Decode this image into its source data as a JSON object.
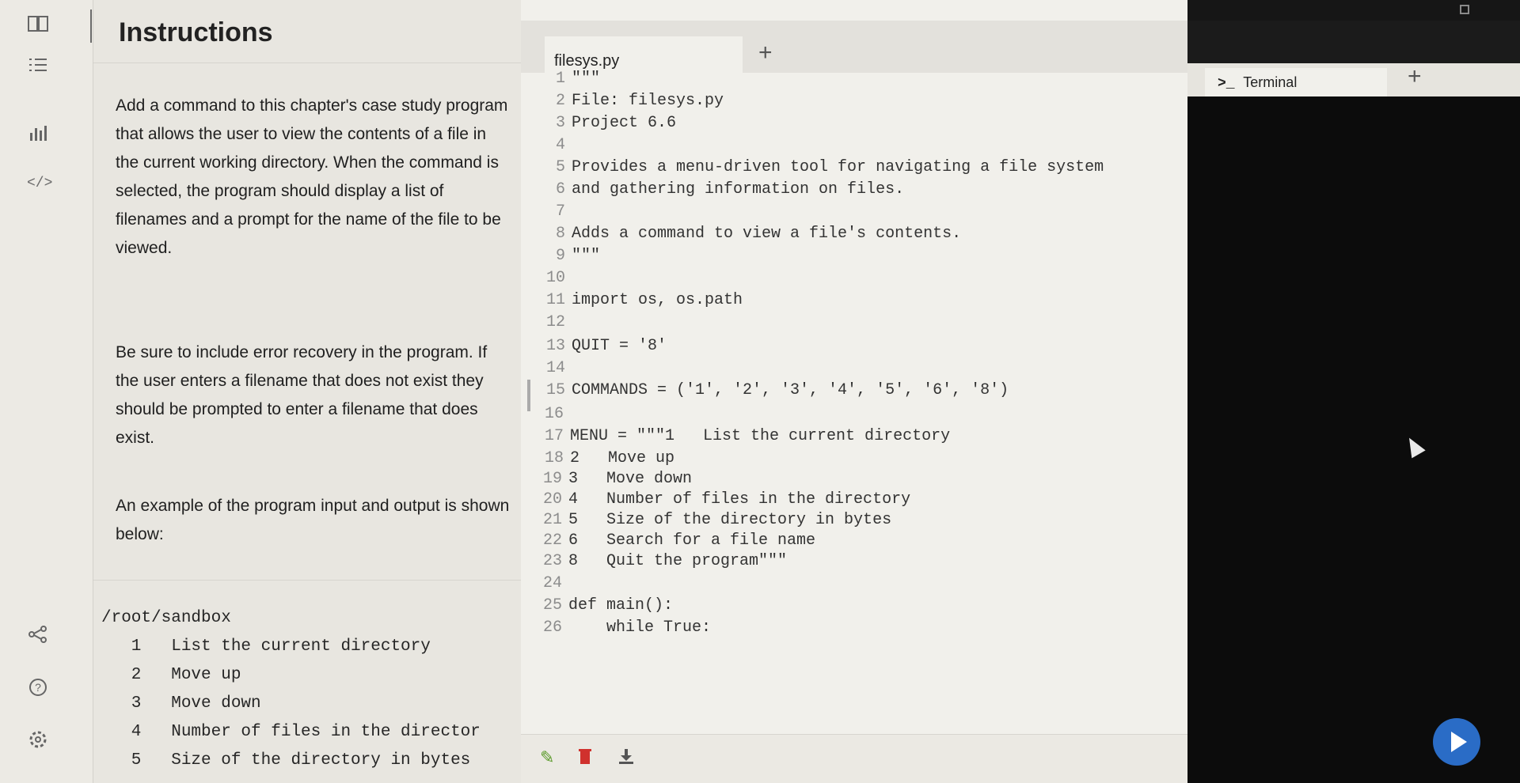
{
  "instructions": {
    "title": "Instructions",
    "paragraph1": "Add a command to this chapter's case study program that allows the user to view the contents of a file in the current working directory. When the command is selected, the program should display a list of filenames and a prompt for the name of the file to be viewed.",
    "paragraph2": "Be sure to include error recovery in the program. If the user enters a filename that does not exist they should be prompted to enter a filename that does exist.",
    "paragraph3": "An example of the program input and output is shown below:",
    "sample": [
      "/root/sandbox",
      "   1   List the current directory",
      "   2   Move up",
      "   3   Move down",
      "   4   Number of files in the director",
      "   5   Size of the directory in bytes"
    ]
  },
  "editor": {
    "tab_label": "filesys.py",
    "add_tab": "+",
    "lines": [
      {
        "n": "1",
        "t": "\"\"\""
      },
      {
        "n": "2",
        "t": "File: filesys.py"
      },
      {
        "n": "3",
        "t": "Project 6.6"
      },
      {
        "n": "4",
        "t": ""
      },
      {
        "n": "5",
        "t": "Provides a menu-driven tool for navigating a file system"
      },
      {
        "n": "6",
        "t": "and gathering information on files."
      },
      {
        "n": "7",
        "t": ""
      },
      {
        "n": "8",
        "t": "Adds a command to view a file's contents."
      },
      {
        "n": "9",
        "t": "\"\"\""
      },
      {
        "n": "10",
        "t": ""
      },
      {
        "n": "11",
        "t": "import os, os.path"
      },
      {
        "n": "12",
        "t": ""
      },
      {
        "n": "13",
        "t": "QUIT = '8'"
      },
      {
        "n": "14",
        "t": ""
      },
      {
        "n": "15",
        "t": "COMMANDS = ('1', '2', '3', '4', '5', '6', '8')"
      },
      {
        "n": "16",
        "t": ""
      },
      {
        "n": "17",
        "t": "MENU = \"\"\"1   List the current directory"
      },
      {
        "n": "18",
        "t": "2   Move up"
      },
      {
        "n": "19",
        "t": "3   Move down"
      },
      {
        "n": "20",
        "t": "4   Number of files in the directory"
      },
      {
        "n": "21",
        "t": "5   Size of the directory in bytes"
      },
      {
        "n": "22",
        "t": "6   Search for a file name"
      },
      {
        "n": "23",
        "t": "8   Quit the program\"\"\""
      },
      {
        "n": "24",
        "t": ""
      },
      {
        "n": "25",
        "t": "def main():"
      },
      {
        "n": "26",
        "t": "    while True:"
      }
    ]
  },
  "terminal": {
    "prompt_icon": ">_",
    "tab_label": "Terminal",
    "add_tab": "+"
  },
  "icons": [
    "book-icon",
    "list-icon",
    "chart-icon",
    "code-icon",
    "share-icon",
    "help-icon",
    "settings-icon",
    "pencil-icon",
    "trash-icon",
    "download-icon",
    "run-icon"
  ],
  "colors": {
    "run_button": "#2a6cc6",
    "trash": "#d0312d",
    "pencil": "#5a9a2a"
  }
}
